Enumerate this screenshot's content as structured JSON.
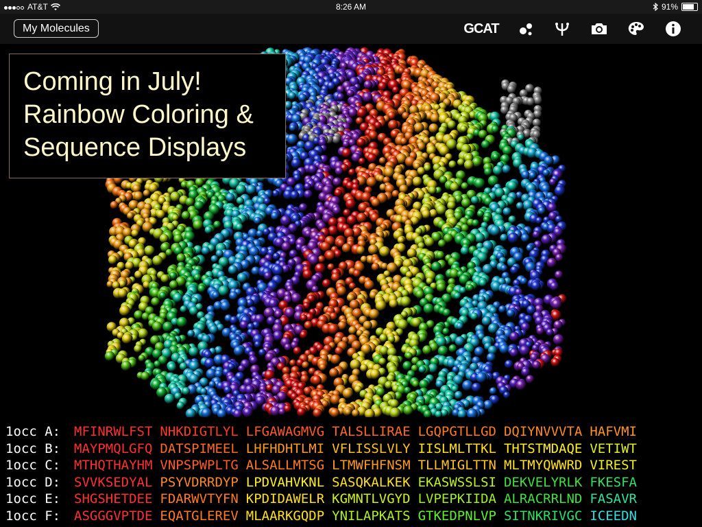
{
  "status_bar": {
    "carrier": "AT&T",
    "time": "8:26 AM",
    "battery": "91%",
    "battery_level": 0.91
  },
  "toolbar": {
    "my_molecules_label": "My Molecules",
    "gcat_label": "GCAT",
    "icons": [
      "molecule-style-icon",
      "hydrogen-bond-icon",
      "camera-icon",
      "palette-icon",
      "info-icon"
    ]
  },
  "announcement": {
    "line1": "Coming in July!",
    "line2": "Rainbow Coloring &",
    "line3": "Sequence Displays"
  },
  "sequences": [
    {
      "label": "1occ A:",
      "chunks": [
        {
          "text": "MFINRWLFST",
          "color": "#ff3030"
        },
        {
          "text": "NHKDIGTLYL",
          "color": "#ff3c28"
        },
        {
          "text": "LFGAWAGMVG",
          "color": "#ff5a28"
        },
        {
          "text": "TALSLLIRAE",
          "color": "#ff6a20"
        },
        {
          "text": "LGQPGTLLGD",
          "color": "#ff7a20"
        },
        {
          "text": "DQIYNVVVTA",
          "color": "#ff8a1e"
        },
        {
          "text": "HAFVMI",
          "color": "#ff9420"
        }
      ]
    },
    {
      "label": "1occ B:",
      "chunks": [
        {
          "text": "MAYPMQLGFQ",
          "color": "#ff3030"
        },
        {
          "text": "DATSPIMEEL",
          "color": "#ff6a20"
        },
        {
          "text": "LHFHDHTLMI",
          "color": "#ff9a20"
        },
        {
          "text": "VFLISSLVLY",
          "color": "#ffc020"
        },
        {
          "text": "IISLMLTTKL",
          "color": "#ffe020"
        },
        {
          "text": "THTSTMDAQE",
          "color": "#fff020"
        },
        {
          "text": "VETIWT",
          "color": "#e0f020"
        }
      ]
    },
    {
      "label": "1occ C:",
      "chunks": [
        {
          "text": "MTHQTHAYHM",
          "color": "#ff3030"
        },
        {
          "text": "VNPSPWPLTG",
          "color": "#ff5a28"
        },
        {
          "text": "ALSALLMTSG",
          "color": "#ff7a20"
        },
        {
          "text": "LTMWFHFNSM",
          "color": "#ff9a20"
        },
        {
          "text": "TLLMIGLTTN",
          "color": "#ffc020"
        },
        {
          "text": "MLTMYQWWRD",
          "color": "#ffe020"
        },
        {
          "text": "VIREST",
          "color": "#f0f020"
        }
      ]
    },
    {
      "label": "1occ D:",
      "chunks": [
        {
          "text": "SVVKSEDYAL",
          "color": "#ff3030"
        },
        {
          "text": "PSYVDRRDYP",
          "color": "#ff8a20"
        },
        {
          "text": "LPDVAHVKNL",
          "color": "#fff020"
        },
        {
          "text": "SASQKALKEK",
          "color": "#ffe020"
        },
        {
          "text": "EKASWSSLSI",
          "color": "#c0f020"
        },
        {
          "text": "DEKVELYRLK",
          "color": "#40e040"
        },
        {
          "text": "FKESFA",
          "color": "#30e060"
        }
      ]
    },
    {
      "label": "1occ E:",
      "chunks": [
        {
          "text": "SHGSHETDEE",
          "color": "#ff3030"
        },
        {
          "text": "FDARWVTYFN",
          "color": "#ff7a20"
        },
        {
          "text": "KPDIDAWELR",
          "color": "#ffe020"
        },
        {
          "text": "KGMNTLVGYD",
          "color": "#d0f020"
        },
        {
          "text": "LVPEPKIIDA",
          "color": "#a0f020"
        },
        {
          "text": "ALRACRRLND",
          "color": "#40e040"
        },
        {
          "text": "FASAVR",
          "color": "#30e0a0"
        }
      ]
    },
    {
      "label": "1occ F:",
      "chunks": [
        {
          "text": "ASGGGVPTDE",
          "color": "#ff3030"
        },
        {
          "text": "EQATGLEREV",
          "color": "#ff7a20"
        },
        {
          "text": "MLAARKGQDP",
          "color": "#ffe020"
        },
        {
          "text": "YNILAPKATS",
          "color": "#b0f020"
        },
        {
          "text": "GTKEDPNLVP",
          "color": "#60f030"
        },
        {
          "text": "SITNKRIVGC",
          "color": "#30e060"
        },
        {
          "text": "ICEEDN",
          "color": "#30e0e0"
        }
      ]
    }
  ]
}
